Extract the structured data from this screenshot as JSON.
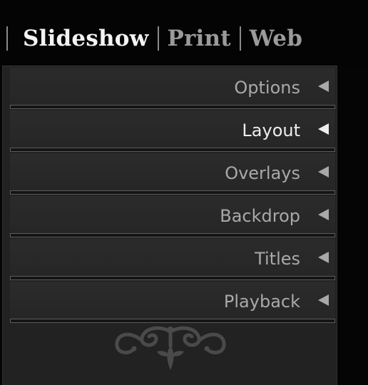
{
  "modules": {
    "items": [
      {
        "label": "Slideshow",
        "active": true
      },
      {
        "label": "Print",
        "active": false
      },
      {
        "label": "Web",
        "active": false
      }
    ]
  },
  "panel": {
    "sections": [
      {
        "label": "Options",
        "state": "collapsed"
      },
      {
        "label": "Layout",
        "state": "collapsed",
        "highlighted": true
      },
      {
        "label": "Overlays",
        "state": "collapsed"
      },
      {
        "label": "Backdrop",
        "state": "collapsed"
      },
      {
        "label": "Titles",
        "state": "collapsed"
      },
      {
        "label": "Playback",
        "state": "collapsed"
      }
    ],
    "end_mark_icon": "flourish-end-mark-icon"
  },
  "colors": {
    "background": "#050505",
    "panel": "#222222",
    "text_active": "#eeeeee",
    "text_inactive": "#a9a9a9"
  }
}
